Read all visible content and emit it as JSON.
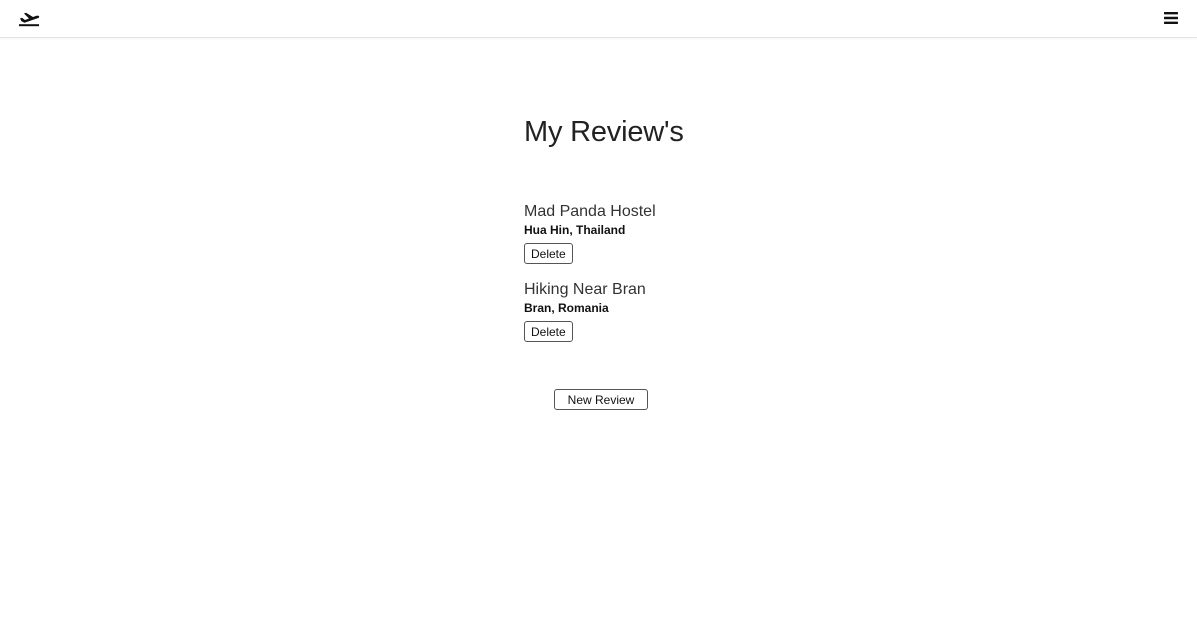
{
  "navbar": {
    "logo_icon": "airplane-departure-icon",
    "menu_icon": "hamburger-menu-icon"
  },
  "page": {
    "title": "My Review's"
  },
  "reviews": [
    {
      "title": "Mad Panda Hostel",
      "location": "Hua Hin, Thailand",
      "delete_label": "Delete"
    },
    {
      "title": "Hiking Near Bran",
      "location": "Bran, Romania",
      "delete_label": "Delete"
    }
  ],
  "actions": {
    "new_review_label": "New Review"
  },
  "colors": {
    "background": "#ffffff",
    "text": "#1a1a1a",
    "border": "#555555"
  }
}
